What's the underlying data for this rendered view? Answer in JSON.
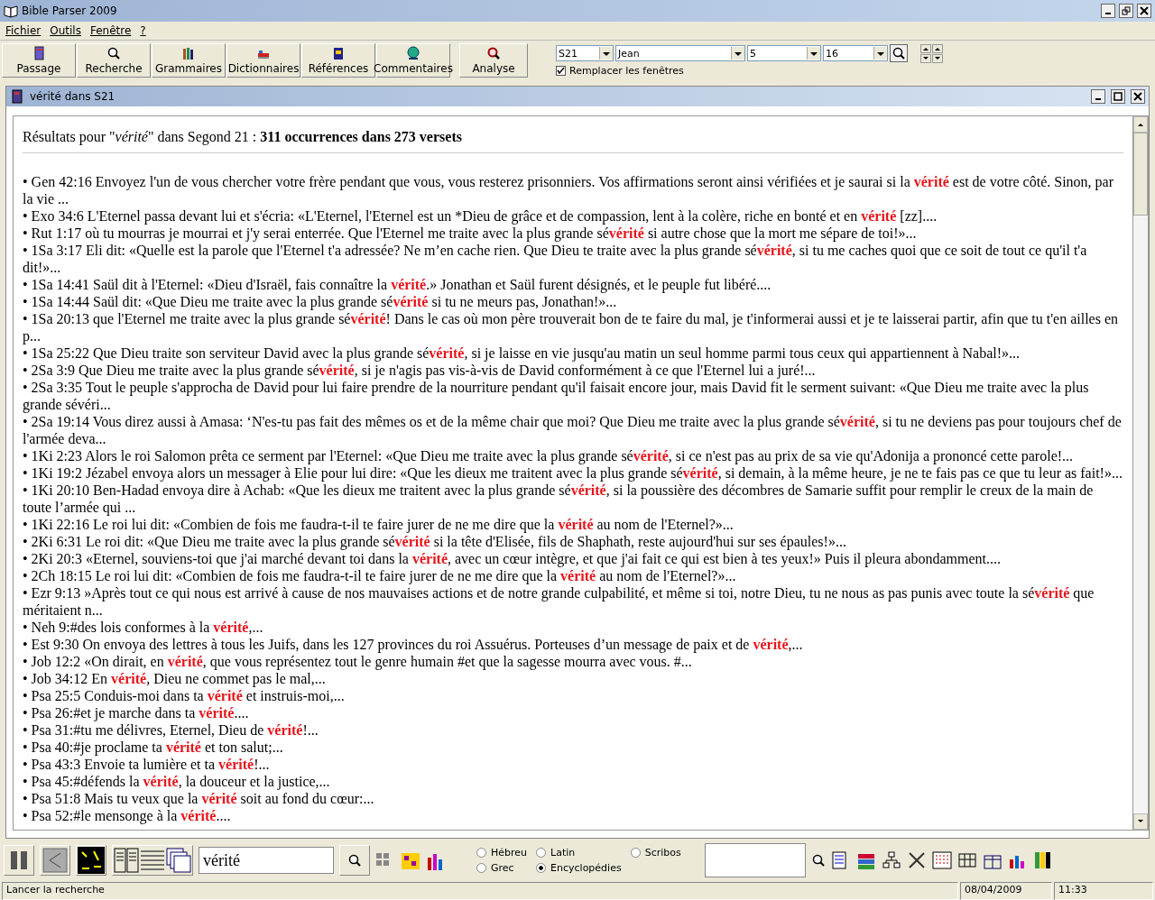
{
  "window": {
    "title": "Bible Parser 2009"
  },
  "menu": [
    "Fichier",
    "Outils",
    "Fenêtre",
    "?"
  ],
  "toolbar": {
    "buttons": [
      "Passage",
      "Recherche",
      "Grammaires",
      "Dictionnaires",
      "Références",
      "Commentaires",
      "Analyse"
    ]
  },
  "navigation": {
    "version": "S21",
    "book": "Jean",
    "chapter": "5",
    "verse": "16",
    "replace": {
      "label": "Remplacer les fenêtres",
      "checked": true
    }
  },
  "document": {
    "title": "vérité dans S21",
    "heading": "Résultats pour \"*vérité*\" dans Segond 21 : **311 occurrences dans 273 versets**",
    "results": [
      "• Gen 42:16 Envoyez l'un de vous chercher votre frère pendant que vous, vous resterez prisonniers. Vos affirmations seront ainsi vérifiées et je saurai si la **vérité** est de votre côté. Sinon, par la vie ...",
      "• Exo 34:6 L'Eternel passa devant lui et s'écria: «L'Eternel, l'Eternel est un *Dieu de grâce et de compassion, lent à la colère, riche en bonté et en **vérité** [zz]....",
      "• Rut 1:17 où tu mourras je mourrai et j'y serai enterrée. Que l'Eternel me traite avec la plus grande sé**vérité** si autre chose que la mort me sépare de toi!»...",
      "• 1Sa 3:17 Eli dit: «Quelle est la parole que l'Eternel t'a adressée? Ne m’en cache rien. Que Dieu te traite avec la plus grande sé**vérité**, si tu me caches quoi que ce soit de tout ce qu'il t'a dit!»...",
      "• 1Sa 14:41 Saül dit à l'Eternel: «Dieu d'Israël, fais connaître la **vérité**.» Jonathan et Saül furent désignés, et le peuple fut libéré....",
      "• 1Sa 14:44 Saül dit: «Que Dieu me traite avec la plus grande sé**vérité** si tu ne meurs pas, Jonathan!»...",
      "• 1Sa 20:13 que l'Eternel me traite avec la plus grande sé**vérité**! Dans le cas où mon père trouverait bon de te faire du mal, je t'informerai aussi et je te laisserai partir, afin que tu t'en ailles en p...",
      "• 1Sa 25:22 Que Dieu traite son serviteur David avec la plus grande sé**vérité**, si je laisse en vie jusqu'au matin un seul homme parmi tous ceux qui appartiennent à Nabal!»...",
      "• 2Sa 3:9 Que Dieu me traite avec la plus grande sé**vérité**, si je n'agis pas vis-à-vis de David conformément à ce que l'Eternel lui a juré!...",
      "• 2Sa 3:35 Tout le peuple s'approcha de David pour lui faire prendre de la nourriture pendant qu'il faisait encore jour, mais David fit le serment suivant: «Que Dieu me traite avec la plus grande sévéri...",
      "• 2Sa 19:14 Vous direz aussi à Amasa: ‘N'es-tu pas fait des mêmes os et de la même chair que moi? Que Dieu me traite avec la plus grande sé**vérité**, si tu ne deviens pas pour toujours chef de l'armée deva...",
      "• 1Ki 2:23 Alors le roi Salomon prêta ce serment par l'Eternel: «Que Dieu me traite avec la plus grande sé**vérité**, si ce n'est pas au prix de sa vie qu'Adonija a prononcé cette parole!...",
      "• 1Ki 19:2 Jézabel envoya alors un messager à Elie pour lui dire: «Que les dieux me traitent avec la plus grande sé**vérité**, si demain, à la même heure, je ne te fais pas ce que tu leur as fait!»...",
      "• 1Ki 20:10 Ben-Hadad envoya dire à Achab: «Que les dieux me traitent avec la plus grande sé**vérité**, si la poussière des décombres de Samarie suffit pour remplir le creux de la main de toute l’armée qui ...",
      "• 1Ki 22:16 Le roi lui dit: «Combien de fois me faudra-t-il te faire jurer de ne me dire que la **vérité** au nom de l'Eternel?»...",
      "• 2Ki 6:31 Le roi dit: «Que Dieu me traite avec la plus grande sé**vérité** si la tête d'Elisée, fils de Shaphath, reste aujourd'hui sur ses épaules!»...",
      "• 2Ki 20:3 «Eternel, souviens-toi que j'ai marché devant toi dans la **vérité**, avec un cœur intègre, et que j'ai fait ce qui est bien à tes yeux!» Puis il pleura abondamment....",
      "• 2Ch 18:15 Le roi lui dit: «Combien de fois me faudra-t-il te faire jurer de ne me dire que la **vérité** au nom de l'Eternel?»...",
      "• Ezr 9:13 »Après tout ce qui nous est arrivé à cause de nos mauvaises actions et de notre grande culpabilité, et même si toi, notre Dieu, tu ne nous as pas punis avec toute la sé**vérité** que méritaient n...",
      "• Neh 9:#des lois conformes à la **vérité**,...",
      "• Est 9:30 On envoya des lettres à tous les Juifs, dans les 127 provinces du roi Assuérus. Porteuses d’un message de paix et de **vérité**,...",
      "• Job 12:2 «On dirait, en **vérité**, que vous représentez tout le genre humain #et que la sagesse mourra avec vous. #...",
      "• Job 34:12 En **vérité**, Dieu ne commet pas le mal,...",
      "• Psa 25:5 Conduis-moi dans ta **vérité** et instruis-moi,...",
      "• Psa 26:#et je marche dans ta **vérité**....",
      "• Psa 31:#tu me délivres, Eternel, Dieu de **vérité**!...",
      "• Psa 40:#je proclame ta **vérité** et ton salut;...",
      "• Psa 43:3 Envoie ta lumière et ta **vérité**!...",
      "• Psa 45:#défends la **vérité**, la douceur et la justice,...",
      "• Psa 51:8 Mais tu veux que la **vérité** soit au fond du cœur:...",
      "• Psa 52:#le mensonge à la **vérité**...."
    ]
  },
  "bottom_toolbar": {
    "search_value": "vérité",
    "languages": [
      {
        "label": "Hébreu",
        "selected": false
      },
      {
        "label": "Latin",
        "selected": false
      },
      {
        "label": "Scribos",
        "selected": false
      },
      {
        "label": "Grec",
        "selected": false
      },
      {
        "label": "Encyclopédies",
        "selected": true
      }
    ]
  },
  "status_bar": {
    "message": "Lancer la recherche",
    "date": "08/04/2009",
    "time": "11:33"
  }
}
